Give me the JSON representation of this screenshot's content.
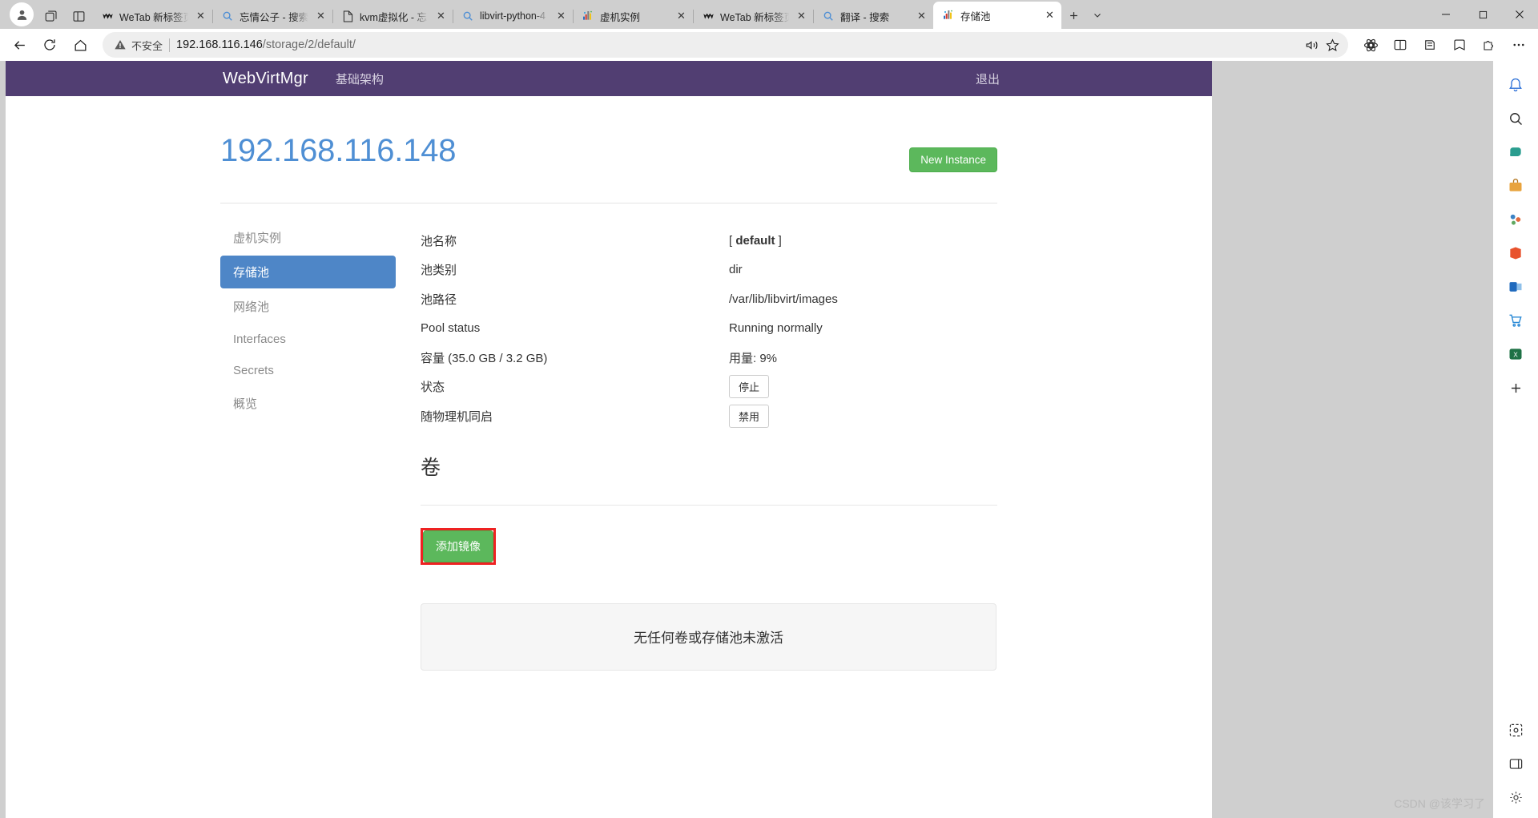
{
  "browser": {
    "tabs": [
      {
        "title": "WeTab 新标签页",
        "favicon": "wetab-icon",
        "active": false
      },
      {
        "title": "忘情公子 - 搜索",
        "favicon": "search-icon",
        "active": false
      },
      {
        "title": "kvm虚拟化 - 忘",
        "favicon": "document-icon",
        "active": false
      },
      {
        "title": "libvirt-python-4",
        "favicon": "search-icon",
        "active": false
      },
      {
        "title": "虚机实例",
        "favicon": "webvirtmgr-icon",
        "active": false
      },
      {
        "title": "WeTab 新标签页",
        "favicon": "wetab-icon",
        "active": false
      },
      {
        "title": "翻译 - 搜索",
        "favicon": "search-icon",
        "active": false
      },
      {
        "title": "存储池",
        "favicon": "webvirtmgr-icon",
        "active": true
      }
    ],
    "tab_close_label": "✕",
    "new_tab_label": "+",
    "tab_dropdown_label": "⌄",
    "window_controls": {
      "minimize": "—",
      "maximize": "▢",
      "close": "✕"
    },
    "toolbar": {
      "back": "back-arrow-icon",
      "refresh": "refresh-icon",
      "home": "home-icon",
      "security_label": "不安全",
      "url_host": "192.168.116.146",
      "url_path": "/storage/2/default/",
      "read_aloud": "read-aloud-icon",
      "favorite": "star-icon",
      "settings_more": "..."
    }
  },
  "app": {
    "brand": "WebVirtMgr",
    "nav_links": [
      "基础架构"
    ],
    "logout": "退出"
  },
  "page": {
    "host_title": "192.168.116.148",
    "new_instance_label": "New Instance",
    "side_nav": [
      {
        "label": "虚机实例",
        "active": false
      },
      {
        "label": "存储池",
        "active": true
      },
      {
        "label": "网络池",
        "active": false
      },
      {
        "label": "Interfaces",
        "active": false
      },
      {
        "label": "Secrets",
        "active": false
      },
      {
        "label": "概览",
        "active": false
      }
    ],
    "details": [
      {
        "label": "池名称",
        "value": "[ default ]",
        "bold": true,
        "type": "text"
      },
      {
        "label": "池类别",
        "value": "dir",
        "type": "text"
      },
      {
        "label": "池路径",
        "value": "/var/lib/libvirt/images",
        "type": "text"
      },
      {
        "label": "Pool status",
        "value": "Running normally",
        "type": "text"
      },
      {
        "label": "容量 (35.0 GB / 3.2 GB)",
        "value": "用量: 9%",
        "type": "text"
      },
      {
        "label": "状态",
        "value": "停止",
        "type": "button"
      },
      {
        "label": "随物理机同启",
        "value": "禁用",
        "type": "button"
      }
    ],
    "volumes_title": "卷",
    "add_image_label": "添加镜像",
    "empty_message": "无任何卷或存储池未激活"
  },
  "watermark": "CSDN @该学习了",
  "colors": {
    "navbar_purple": "#513e72",
    "sidebar_active_blue": "#4e86c7",
    "title_blue": "#4f8fd4",
    "button_green": "#5cb85c",
    "highlight_red": "#ee2222"
  }
}
